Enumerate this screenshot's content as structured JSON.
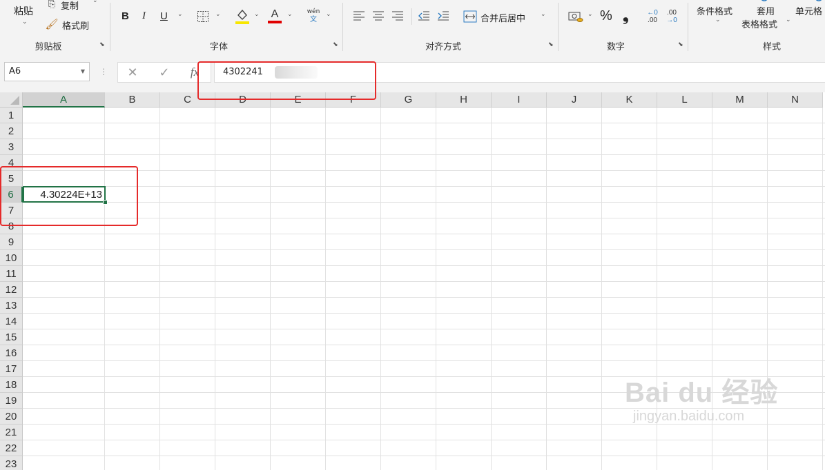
{
  "ribbon": {
    "clipboard": {
      "paste_label": "粘贴",
      "copy_label": "复制",
      "format_painter_label": "格式刷",
      "group_label": "剪贴板"
    },
    "font": {
      "bold": "B",
      "italic": "I",
      "underline": "U",
      "font_color_glyph": "A",
      "phonetic_top": "wén",
      "phonetic_bottom": "文",
      "group_label": "字体"
    },
    "alignment": {
      "merge_center_label": "合并后居中",
      "group_label": "对齐方式"
    },
    "number": {
      "percent": "%",
      "comma": "❟",
      "increase_decimal_top": "←0",
      "increase_decimal_bottom": ".00",
      "decrease_decimal_top": ".00",
      "decrease_decimal_bottom": "→0",
      "group_label": "数字"
    },
    "styles": {
      "conditional_format_label": "条件格式",
      "table_format_top": "套用",
      "table_format_bottom": "表格格式",
      "cell_styles_label": "单元格",
      "group_label": "样式"
    },
    "colors": {
      "highlight": "#f7e600",
      "font_color": "#e00000"
    }
  },
  "formula_bar": {
    "name_box": "A6",
    "cancel_glyph": "✕",
    "enter_glyph": "✓",
    "fx_glyph": "fx",
    "value": "4302241"
  },
  "sheet": {
    "columns": [
      "A",
      "B",
      "C",
      "D",
      "E",
      "F",
      "G",
      "H",
      "I",
      "J",
      "K",
      "L",
      "M",
      "N"
    ],
    "rows": [
      "1",
      "2",
      "3",
      "4",
      "5",
      "6",
      "7",
      "8",
      "9",
      "10",
      "11",
      "12",
      "13",
      "14",
      "15",
      "16",
      "17",
      "18",
      "19",
      "20",
      "21",
      "22",
      "23"
    ],
    "selected_column": "A",
    "selected_row": "6",
    "cell_A6": "4.30224E+13"
  },
  "watermark": {
    "top": "Bai du 经验",
    "bottom": "jingyan.baidu.com"
  },
  "annotation_color": "#e52a2a"
}
